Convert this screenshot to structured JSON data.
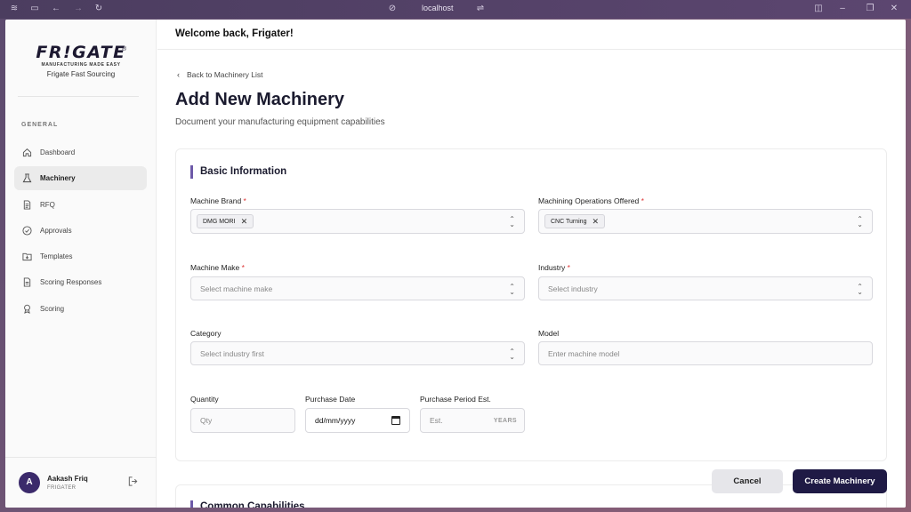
{
  "browser": {
    "url": "localhost"
  },
  "brand": {
    "logo_text": "FR!GATE",
    "registered": "®",
    "tagline": "MANUFACTURING MADE EASY",
    "subtitle": "Frigate Fast Sourcing"
  },
  "sidebar": {
    "section_label": "GENERAL",
    "items": [
      {
        "label": "Dashboard",
        "icon": "home-icon",
        "active": false
      },
      {
        "label": "Machinery",
        "icon": "flask-icon",
        "active": true
      },
      {
        "label": "RFQ",
        "icon": "document-icon",
        "active": false
      },
      {
        "label": "Approvals",
        "icon": "check-circle-icon",
        "active": false
      },
      {
        "label": "Templates",
        "icon": "folder-download-icon",
        "active": false
      },
      {
        "label": "Scoring Responses",
        "icon": "file-text-icon",
        "active": false
      },
      {
        "label": "Scoring",
        "icon": "award-icon",
        "active": false
      }
    ],
    "user": {
      "initial": "A",
      "name": "Aakash Friq",
      "role": "FRIGATER"
    }
  },
  "header": {
    "welcome": "Welcome back, Frigater!"
  },
  "page": {
    "back_link": "Back to Machinery List",
    "title": "Add New Machinery",
    "subtitle": "Document your manufacturing equipment capabilities"
  },
  "form": {
    "section_title": "Basic Information",
    "machine_brand": {
      "label": "Machine Brand",
      "chip": "DMG MORI"
    },
    "operations": {
      "label": "Machining Operations Offered",
      "chip": "CNC Turning"
    },
    "machine_make": {
      "label": "Machine Make",
      "placeholder": "Select machine make"
    },
    "industry": {
      "label": "Industry",
      "placeholder": "Select industry"
    },
    "category": {
      "label": "Category",
      "placeholder": "Select industry first"
    },
    "model": {
      "label": "Model",
      "placeholder": "Enter machine model"
    },
    "quantity": {
      "label": "Quantity",
      "placeholder": "Qty"
    },
    "purchase_date": {
      "label": "Purchase Date",
      "value": "dd/mm/yyyy"
    },
    "purchase_period": {
      "label": "Purchase Period Est.",
      "placeholder": "Est.",
      "suffix": "YEARS"
    },
    "required_mark": "*"
  },
  "actions": {
    "cancel": "Cancel",
    "create": "Create Machinery"
  },
  "next_section": {
    "title": "Common Capabilities"
  },
  "colors": {
    "primary": "#1f1a45",
    "accent": "#6d5aa8",
    "required": "#dd3333"
  }
}
